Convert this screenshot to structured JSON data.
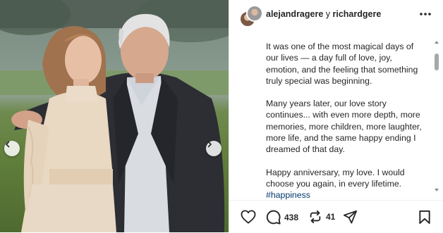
{
  "post": {
    "author_primary": "alejandragere",
    "author_connector": " y ",
    "author_secondary": "richardgere"
  },
  "caption": {
    "paragraph_1": "It was one of the most magical days of our lives — a day full of love, joy, emotion, and the feeling that something truly special was beginning.",
    "paragraph_2": "Many years later, our love story continues... with even more depth, more memories, more children, more laughter, more life, and the same happy ending I dreamed of that day.",
    "paragraph_3": "Happy anniversary, my love. I would choose you again, in every lifetime.",
    "hashtag": "#happiness"
  },
  "actions": {
    "comment_count": "438",
    "repost_count": "41"
  },
  "icons": {
    "more": "more-options-icon",
    "like": "heart-icon",
    "comment": "comment-icon",
    "repost": "repost-icon",
    "share": "share-icon",
    "save": "bookmark-icon",
    "prev": "chevron-left-icon",
    "next": "chevron-right-icon"
  },
  "colors": {
    "text": "#262626",
    "hashtag": "#00376b",
    "divider": "#efefef"
  }
}
